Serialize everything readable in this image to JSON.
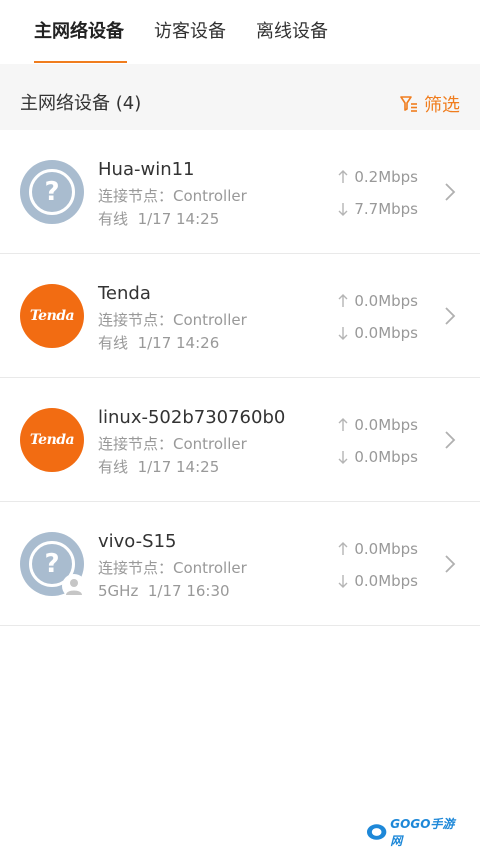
{
  "tabs": [
    {
      "label": "主网络设备",
      "active": true
    },
    {
      "label": "访客设备",
      "active": false
    },
    {
      "label": "离线设备",
      "active": false
    }
  ],
  "section": {
    "title": "主网络设备 (4)",
    "filter_label": "筛选"
  },
  "devices": [
    {
      "name": "Hua-win11",
      "node": "连接节点：Controller",
      "status_label": "有线",
      "time": "1/17 14:25",
      "up": "0.2Mbps",
      "down": "7.7Mbps",
      "icon": "unknown-device-icon"
    },
    {
      "name": "Tenda",
      "node": "连接节点：Controller",
      "status_label": "有线",
      "time": "1/17 14:26",
      "up": "0.0Mbps",
      "down": "0.0Mbps",
      "icon": "tenda-logo",
      "brand_text": "Tenda"
    },
    {
      "name": "linux-502b730760b0",
      "node": "连接节点：Controller",
      "status_label": "有线",
      "time": "1/17 14:25",
      "up": "0.0Mbps",
      "down": "0.0Mbps",
      "icon": "tenda-logo",
      "brand_text": "Tenda"
    },
    {
      "name": "vivo-S15",
      "node": "连接节点：Controller",
      "status_label": "5GHz",
      "time": "1/17 16:30",
      "up": "0.0Mbps",
      "down": "0.0Mbps",
      "icon": "unknown-device-guest-icon"
    }
  ],
  "watermark": {
    "text": "GOGO手游网"
  },
  "colors": {
    "accent": "#f07d1e",
    "tenda_orange": "#f26c12",
    "unknown_gray_blue": "#a9bccf"
  }
}
